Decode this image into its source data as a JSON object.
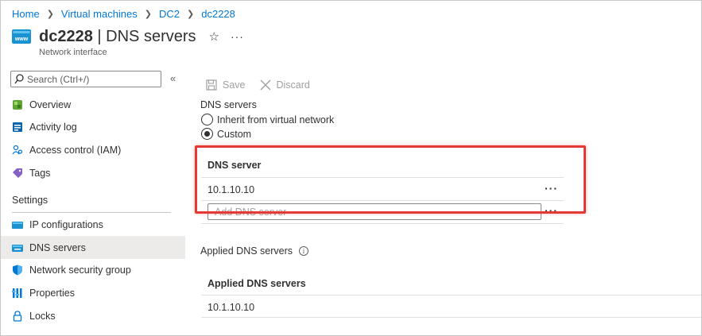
{
  "breadcrumb": [
    "Home",
    "Virtual machines",
    "DC2",
    "dc2228"
  ],
  "title": {
    "name": "dc2228",
    "separator": " | ",
    "section": "DNS servers",
    "subtitle": "Network interface"
  },
  "sidebar": {
    "search_placeholder": "Search (Ctrl+/)",
    "collapse_glyph": "«",
    "items_top": [
      {
        "label": "Overview",
        "icon": "overview-icon"
      },
      {
        "label": "Activity log",
        "icon": "activity-log-icon"
      },
      {
        "label": "Access control (IAM)",
        "icon": "access-control-icon"
      },
      {
        "label": "Tags",
        "icon": "tag-icon"
      }
    ],
    "section_label": "Settings",
    "items_settings": [
      {
        "label": "IP configurations",
        "icon": "ip-config-icon"
      },
      {
        "label": "DNS servers",
        "icon": "dns-icon",
        "active": true
      },
      {
        "label": "Network security group",
        "icon": "shield-icon"
      },
      {
        "label": "Properties",
        "icon": "properties-icon"
      },
      {
        "label": "Locks",
        "icon": "lock-icon"
      }
    ]
  },
  "toolbar": {
    "save_label": "Save",
    "discard_label": "Discard"
  },
  "dns": {
    "section_label": "DNS servers",
    "options": [
      {
        "label": "Inherit from virtual network",
        "checked": false
      },
      {
        "label": "Custom",
        "checked": true
      }
    ],
    "column_header": "DNS server",
    "servers": [
      "10.1.10.10"
    ],
    "add_placeholder": "Add DNS server"
  },
  "applied": {
    "label": "Applied DNS servers",
    "column_header": "Applied DNS servers",
    "values": [
      "10.1.10.10"
    ]
  },
  "colors": {
    "link": "#0078d4",
    "highlight": "#e53935",
    "active_bg": "#edebe9"
  }
}
